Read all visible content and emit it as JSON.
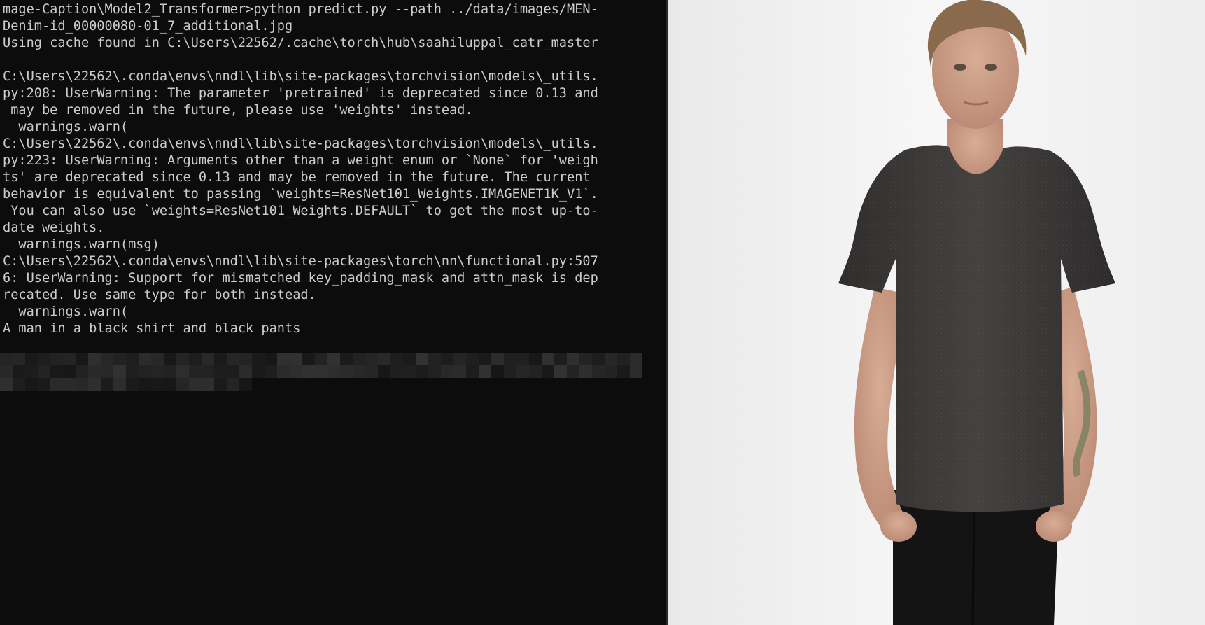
{
  "terminal": {
    "lines": [
      "mage-Caption\\Model2_Transformer>python predict.py --path ../data/images/MEN-",
      "Denim-id_00000080-01_7_additional.jpg",
      "Using cache found in C:\\Users\\22562/.cache\\torch\\hub\\saahiluppal_catr_master",
      "",
      "C:\\Users\\22562\\.conda\\envs\\nndl\\lib\\site-packages\\torchvision\\models\\_utils.",
      "py:208: UserWarning: The parameter 'pretrained' is deprecated since 0.13 and",
      " may be removed in the future, please use 'weights' instead.",
      "  warnings.warn(",
      "C:\\Users\\22562\\.conda\\envs\\nndl\\lib\\site-packages\\torchvision\\models\\_utils.",
      "py:223: UserWarning: Arguments other than a weight enum or `None` for 'weigh",
      "ts' are deprecated since 0.13 and may be removed in the future. The current",
      "behavior is equivalent to passing `weights=ResNet101_Weights.IMAGENET1K_V1`.",
      " You can also use `weights=ResNet101_Weights.DEFAULT` to get the most up-to-",
      "date weights.",
      "  warnings.warn(msg)",
      "C:\\Users\\22562\\.conda\\envs\\nndl\\lib\\site-packages\\torch\\nn\\functional.py:507",
      "6: UserWarning: Support for mismatched key_padding_mask and attn_mask is dep",
      "recated. Use same type for both instead.",
      "  warnings.warn(",
      "A man in a black shirt and black pants"
    ]
  },
  "colors": {
    "terminal_bg": "#0c0c0c",
    "terminal_text": "#cccccc",
    "photo_bg": "#f2f2f2",
    "shirt": "#3b3838",
    "pants": "#141414",
    "skin": "#c99b83",
    "hair": "#8a6a4c"
  },
  "icons": {
    "redacted_prompt": "pixelated-redaction",
    "photo": "model-in-dark-tshirt-photo"
  }
}
